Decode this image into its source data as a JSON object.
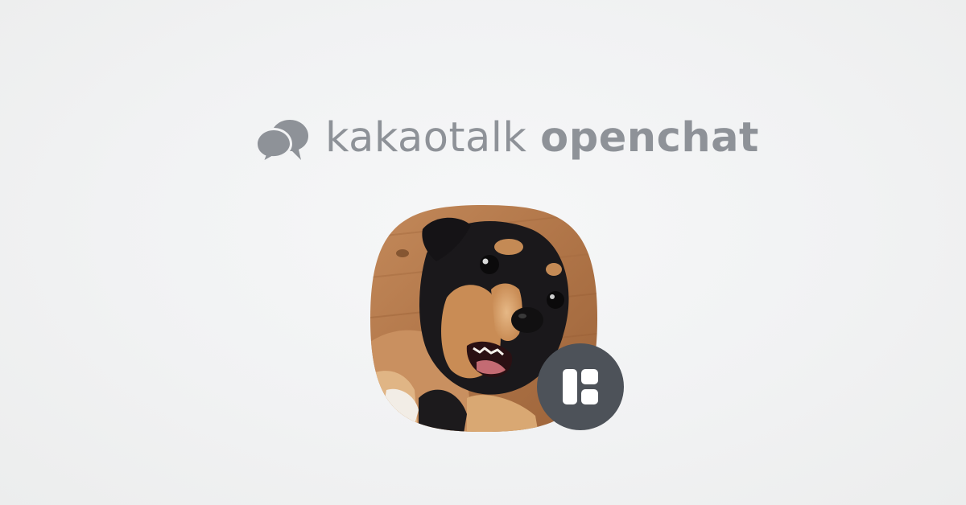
{
  "brand": {
    "name_light": "kakaotalk",
    "name_bold": "openchat",
    "logo_icon": "chat-bubbles-icon",
    "text_color": "#8e9298"
  },
  "profile": {
    "image": "puppy-photo",
    "badge_icon": "openchat-board-icon",
    "badge_color": "#4d5259"
  }
}
